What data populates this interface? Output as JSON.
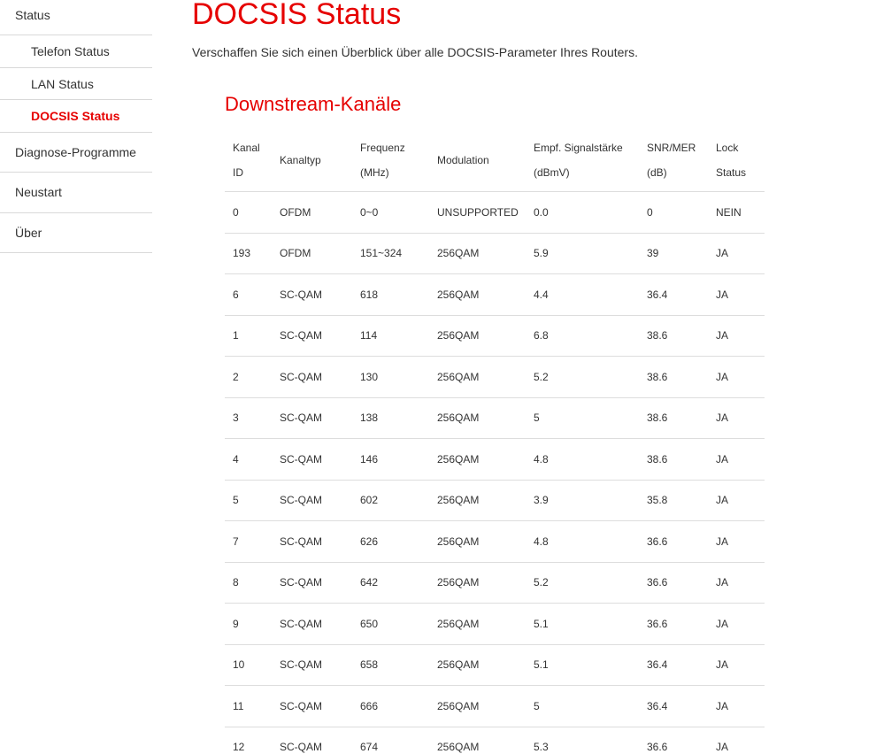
{
  "sidebar": {
    "status": "Status",
    "telefon_status": "Telefon Status",
    "lan_status": "LAN Status",
    "docsis_status": "DOCSIS Status",
    "diagnose": "Diagnose-Programme",
    "neustart": "Neustart",
    "ueber": "Über"
  },
  "main": {
    "title": "DOCSIS Status",
    "description": "Verschaffen Sie sich einen Überblick über alle DOCSIS-Parameter Ihres Routers.",
    "section_title": "Downstream-Kanäle"
  },
  "table": {
    "headers": [
      [
        "Kanal",
        "ID"
      ],
      [
        "Kanaltyp"
      ],
      [
        "Frequenz",
        "(MHz)"
      ],
      [
        "Modulation"
      ],
      [
        "Empf. Signalstärke",
        "(dBmV)"
      ],
      [
        "SNR/MER",
        "(dB)"
      ],
      [
        "Lock",
        "Status"
      ]
    ],
    "rows": [
      [
        "0",
        "OFDM",
        "0~0",
        "UNSUPPORTED",
        "0.0",
        "0",
        "NEIN"
      ],
      [
        "193",
        "OFDM",
        "151~324",
        "256QAM",
        "5.9",
        "39",
        "JA"
      ],
      [
        "6",
        "SC-QAM",
        "618",
        "256QAM",
        "4.4",
        "36.4",
        "JA"
      ],
      [
        "1",
        "SC-QAM",
        "114",
        "256QAM",
        "6.8",
        "38.6",
        "JA"
      ],
      [
        "2",
        "SC-QAM",
        "130",
        "256QAM",
        "5.2",
        "38.6",
        "JA"
      ],
      [
        "3",
        "SC-QAM",
        "138",
        "256QAM",
        "5",
        "38.6",
        "JA"
      ],
      [
        "4",
        "SC-QAM",
        "146",
        "256QAM",
        "4.8",
        "38.6",
        "JA"
      ],
      [
        "5",
        "SC-QAM",
        "602",
        "256QAM",
        "3.9",
        "35.8",
        "JA"
      ],
      [
        "7",
        "SC-QAM",
        "626",
        "256QAM",
        "4.8",
        "36.6",
        "JA"
      ],
      [
        "8",
        "SC-QAM",
        "642",
        "256QAM",
        "5.2",
        "36.6",
        "JA"
      ],
      [
        "9",
        "SC-QAM",
        "650",
        "256QAM",
        "5.1",
        "36.6",
        "JA"
      ],
      [
        "10",
        "SC-QAM",
        "658",
        "256QAM",
        "5.1",
        "36.4",
        "JA"
      ],
      [
        "11",
        "SC-QAM",
        "666",
        "256QAM",
        "5",
        "36.4",
        "JA"
      ],
      [
        "12",
        "SC-QAM",
        "674",
        "256QAM",
        "5.3",
        "36.6",
        "JA"
      ]
    ]
  },
  "colors": {
    "accent": "#e60000",
    "text": "#333333",
    "divider": "#dddddd"
  }
}
